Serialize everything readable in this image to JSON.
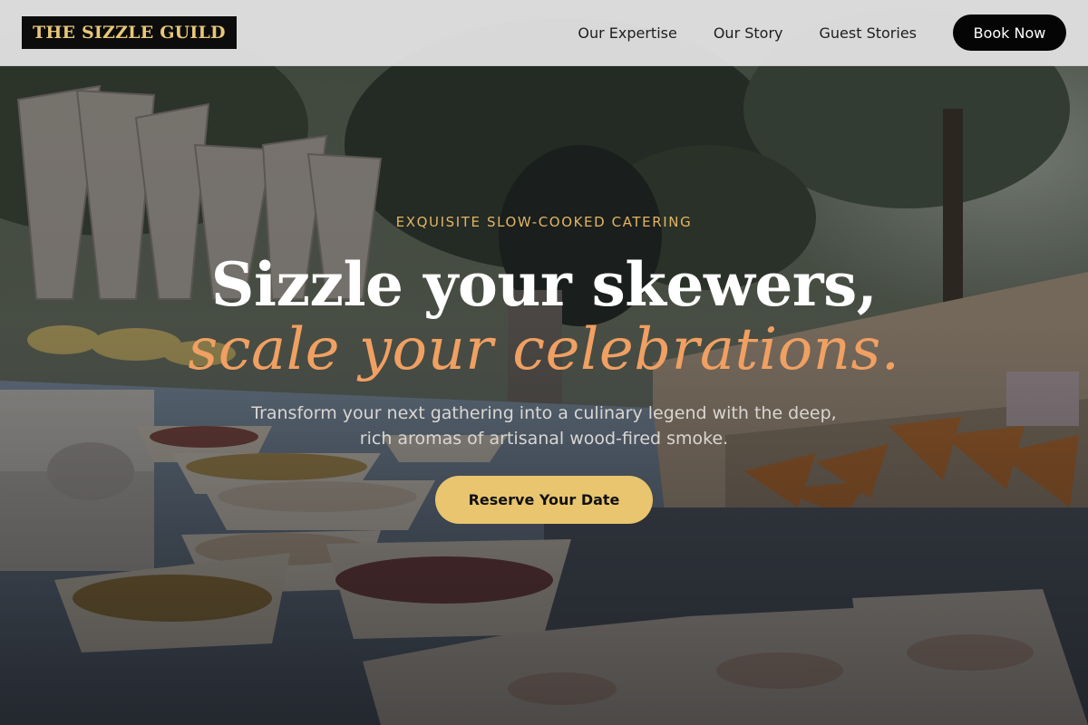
{
  "header": {
    "logo": "THE SIZZLE GUILD",
    "nav": [
      {
        "label": "Our Expertise"
      },
      {
        "label": "Our Story"
      },
      {
        "label": "Guest Stories"
      }
    ],
    "cta_label": "Book Now"
  },
  "hero": {
    "eyebrow": "EXQUISITE SLOW-COOKED CATERING",
    "headline_line1": "Sizzle your skewers,",
    "headline_line2": "scale your celebrations.",
    "subtext": "Transform your next gathering into a culinary legend with the deep, rich aromas of artisanal wood-fired smoke.",
    "cta_label": "Reserve Your Date",
    "background_image": "outdoor-catering-buffet-photo"
  },
  "colors": {
    "logo_bg": "#0c0c0c",
    "logo_text": "#e8c77a",
    "eyebrow": "#e2b564",
    "headline_accent": "#f0a062",
    "cta_bg": "#e8c56e",
    "book_btn_bg": "#050505"
  }
}
